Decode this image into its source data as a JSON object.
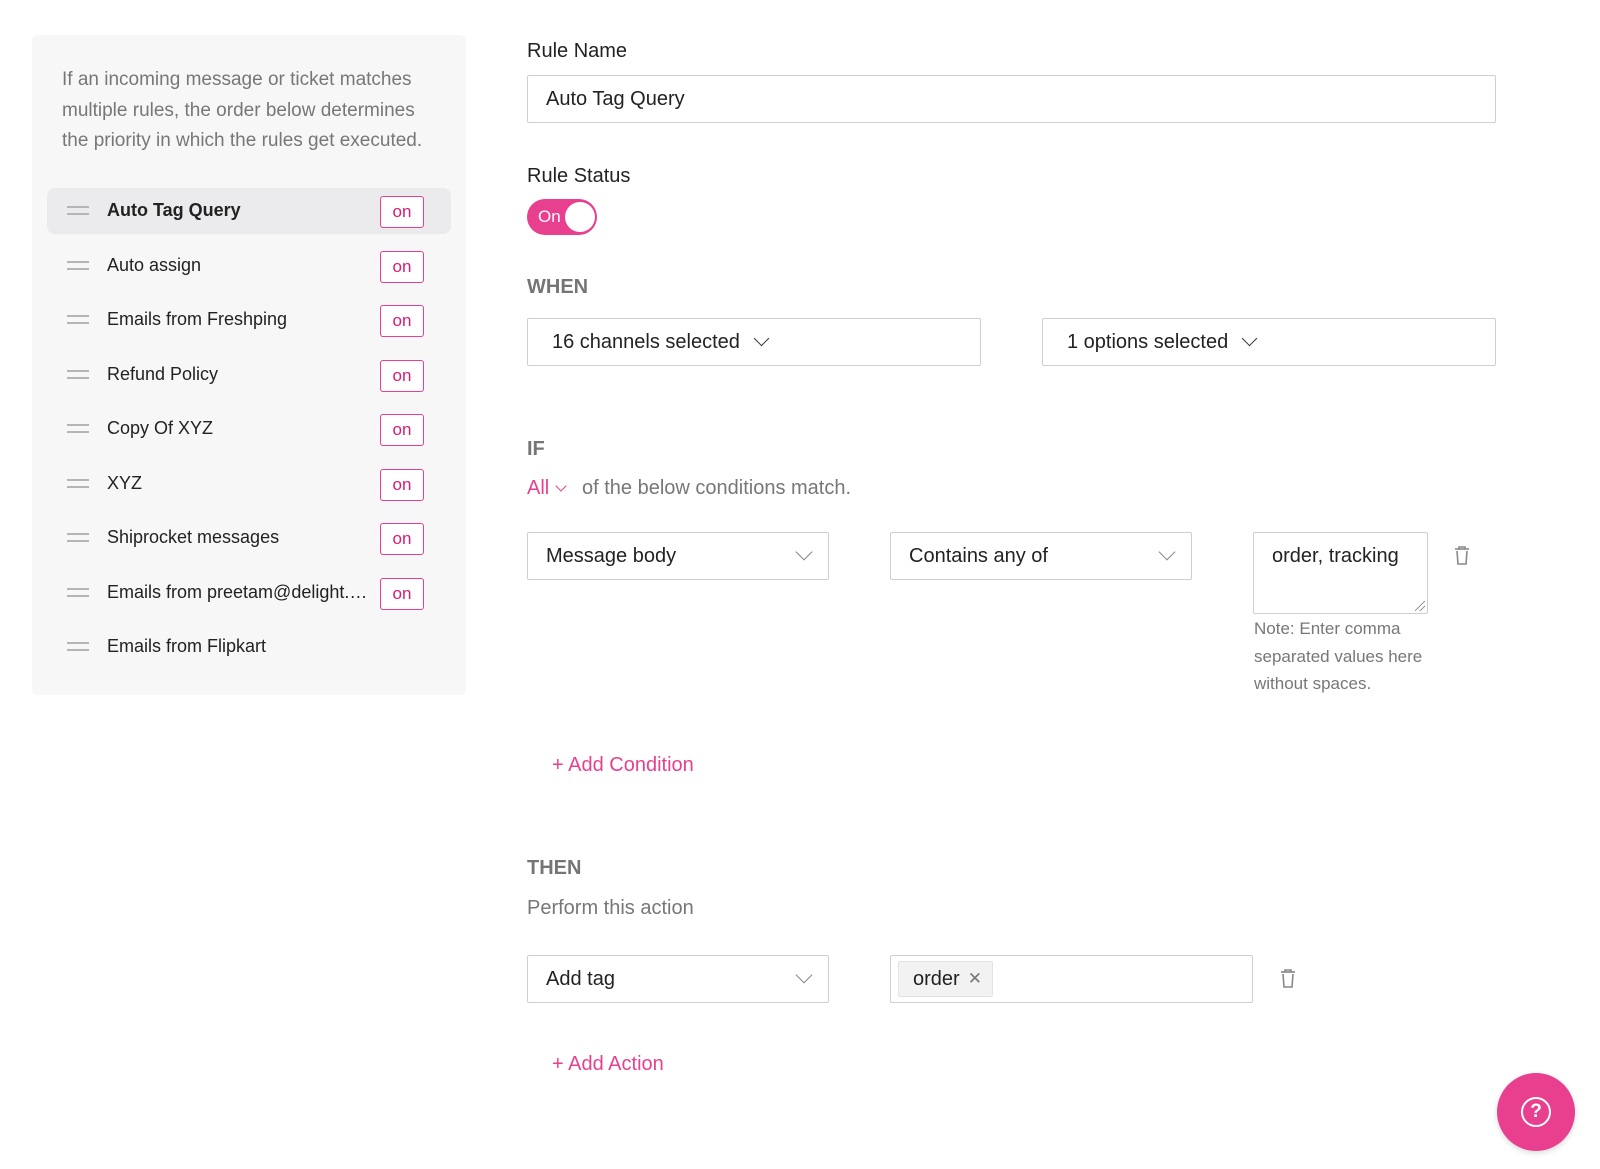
{
  "sidebar": {
    "note": "If an incoming message or ticket matches multiple rules, the order below determines the priority in which the rules get executed.",
    "rules": [
      {
        "name": "Auto Tag Query",
        "status": "on",
        "active": true
      },
      {
        "name": "Auto assign",
        "status": "on"
      },
      {
        "name": "Emails from Freshping",
        "status": "on"
      },
      {
        "name": "Refund Policy",
        "status": "on"
      },
      {
        "name": "Copy Of XYZ",
        "status": "on"
      },
      {
        "name": "XYZ",
        "status": "on"
      },
      {
        "name": "Shiprocket messages",
        "status": "on"
      },
      {
        "name": "Emails from preetam@delight.c...",
        "status": "on"
      },
      {
        "name": "Emails from Flipkart",
        "status": ""
      }
    ]
  },
  "form": {
    "rule_name_label": "Rule Name",
    "rule_name_value": "Auto Tag Query",
    "rule_status_label": "Rule Status",
    "rule_status_toggle": "On",
    "when": {
      "heading": "WHEN",
      "channels": "16 channels selected",
      "options": "1 options selected"
    },
    "if": {
      "heading": "IF",
      "match_mode": "All",
      "match_text": "of the below conditions match.",
      "condition": {
        "field": "Message body",
        "operator": "Contains any of",
        "value": "order, tracking",
        "note": "Note: Enter comma separated values here without spaces."
      },
      "add_condition": "+ Add Condition"
    },
    "then": {
      "heading": "THEN",
      "subtitle": "Perform this action",
      "action": "Add tag",
      "tags": [
        "order"
      ],
      "add_action": "+ Add Action"
    }
  },
  "help_button": {
    "icon": "question-icon",
    "symbol": "?"
  },
  "colors": {
    "accent": "#e8408e",
    "sidebar_bg": "#f7f7f8",
    "muted_text": "#777777"
  }
}
